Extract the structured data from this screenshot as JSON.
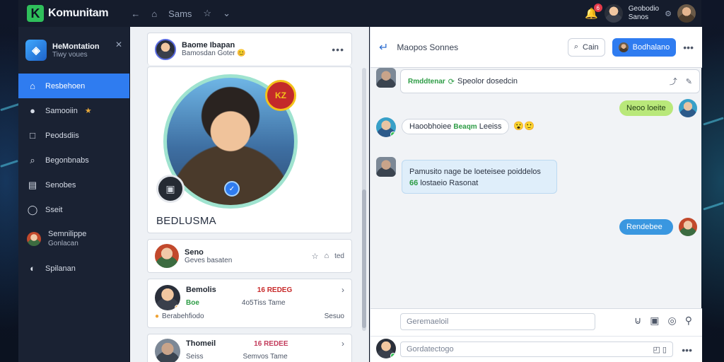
{
  "topbar": {
    "app_name": "Komunitam",
    "nav_label": "Sams",
    "user_name": "Geobodio",
    "user_sub": "Sanos",
    "notification_count": "6"
  },
  "sidebar": {
    "title": "HeMontation",
    "subtitle": "Tiwy voues",
    "items": [
      {
        "label": "Resbehoen",
        "icon": "home-icon"
      },
      {
        "label": "Samooiin",
        "icon": "user-icon"
      },
      {
        "label": "Peodsdiis",
        "icon": "square-icon"
      },
      {
        "label": "Begonbnabs",
        "icon": "search-icon"
      },
      {
        "label": "Senobes",
        "icon": "document-icon"
      },
      {
        "label": "Sseit",
        "icon": "chat-icon"
      },
      {
        "label": "Semnilippe",
        "sub": "Gonlacan",
        "icon": "avatar"
      },
      {
        "label": "Spilanan",
        "icon": "compass-icon"
      }
    ]
  },
  "profile": {
    "header_title": "Baome Ibapan",
    "header_sub": "Bamosdan Goter",
    "hero_badge": "KZ",
    "hero_name": "BEDLUSMA",
    "cards": [
      {
        "name": "Seno",
        "sub": "Geves basaten",
        "right": "ted"
      },
      {
        "name": "Bemolis",
        "sub": "Boe",
        "tag": "16 REDEG",
        "meta": "4o5Tiss Tame",
        "footer": "Berabehfiodo",
        "footer_right": "Sesuo"
      },
      {
        "name": "Thomeil",
        "sub": "Seiss",
        "tag": "16 REDEE",
        "meta": "Semvos Tame"
      }
    ]
  },
  "chat": {
    "title": "Maopos Sonnes",
    "btn_secondary": "Cain",
    "btn_primary": "Bodhalano",
    "messages": [
      {
        "text_green": "Rmddtenar",
        "text": "Speolor dosedcin"
      },
      {
        "text": "Neoo loeite"
      },
      {
        "text": "Haoobhoiee",
        "text_green": "Beaqm",
        "text_tail": "Leeiss"
      },
      {
        "line1": "Pamusito nage be loeteisee poiddelos",
        "line2": "lostaeio Rasonat"
      },
      {
        "text": "Rendebee"
      }
    ],
    "composer_placeholder": "Geremaeloil",
    "composer2_placeholder": "Gordatectogo"
  },
  "colors": {
    "accent": "#2f7cf0",
    "sidebar_bg": "#1a2233",
    "topbar_bg": "#151c2c",
    "green_bubble": "#b9e87a",
    "blue_bubble": "#3a97e0"
  }
}
